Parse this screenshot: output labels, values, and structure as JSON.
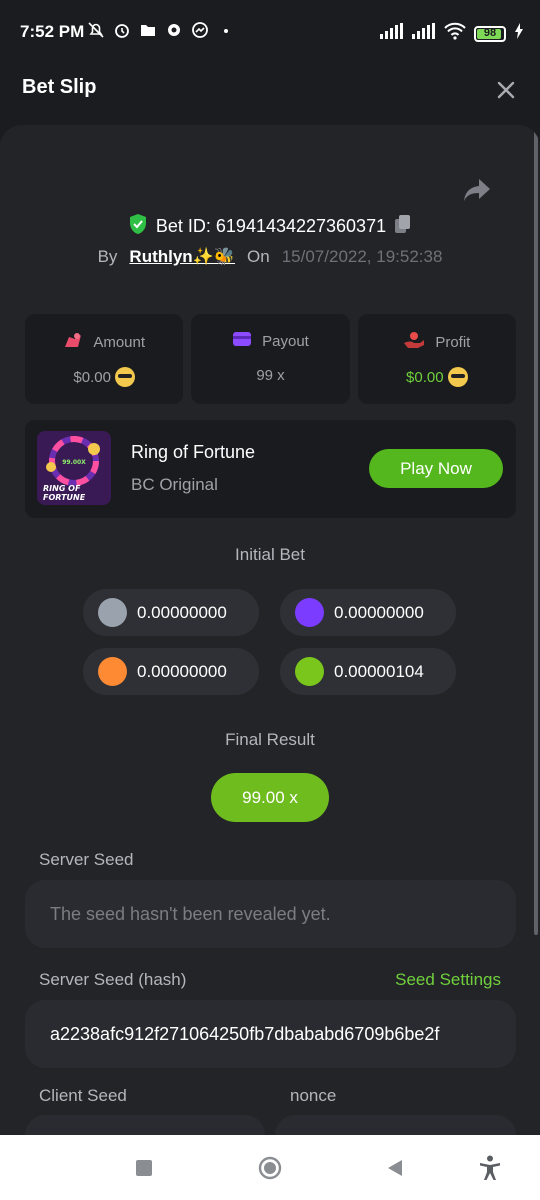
{
  "status_bar": {
    "time": "7:52 PM",
    "battery": "98"
  },
  "header": {
    "title": "Bet Slip"
  },
  "bet": {
    "id_label": "Bet ID: 61941434227360371",
    "by_label": "By",
    "user": "Ruthlyn✨🐝",
    "on_label": "On",
    "date": "15/07/2022, 19:52:38"
  },
  "stats": {
    "amount_label": "Amount",
    "amount_value": "$0.00",
    "payout_label": "Payout",
    "payout_value": "99 x",
    "profit_label": "Profit",
    "profit_value": "$0.00"
  },
  "game": {
    "name": "Ring of Fortune",
    "subtitle": "BC Original",
    "play_label": "Play Now",
    "thumb_multiplier": "99.00X",
    "thumb_line1": "RING OF",
    "thumb_line2": "FORTUNE"
  },
  "initial_bet": {
    "title": "Initial Bet",
    "coins": [
      {
        "color": "#9aa3ad",
        "value": "0.00000000"
      },
      {
        "color": "#7b3cff",
        "value": "0.00000000"
      },
      {
        "color": "#ff8a34",
        "value": "0.00000000"
      },
      {
        "color": "#7ac61d",
        "value": "0.00000104"
      }
    ]
  },
  "final_result": {
    "title": "Final Result",
    "value": "99.00 x"
  },
  "server_seed": {
    "label": "Server Seed",
    "placeholder": "The seed hasn't been revealed yet."
  },
  "server_seed_hash": {
    "label": "Server Seed (hash)",
    "settings_link": "Seed Settings",
    "value": "a2238afc912f271064250fb7dbababd6709b6be2f"
  },
  "client_seed": {
    "label": "Client Seed"
  },
  "nonce": {
    "label": "nonce"
  },
  "colors": {
    "accent_green": "#53b71d",
    "panel": "#1a1b1e",
    "sheet": "#232428"
  }
}
